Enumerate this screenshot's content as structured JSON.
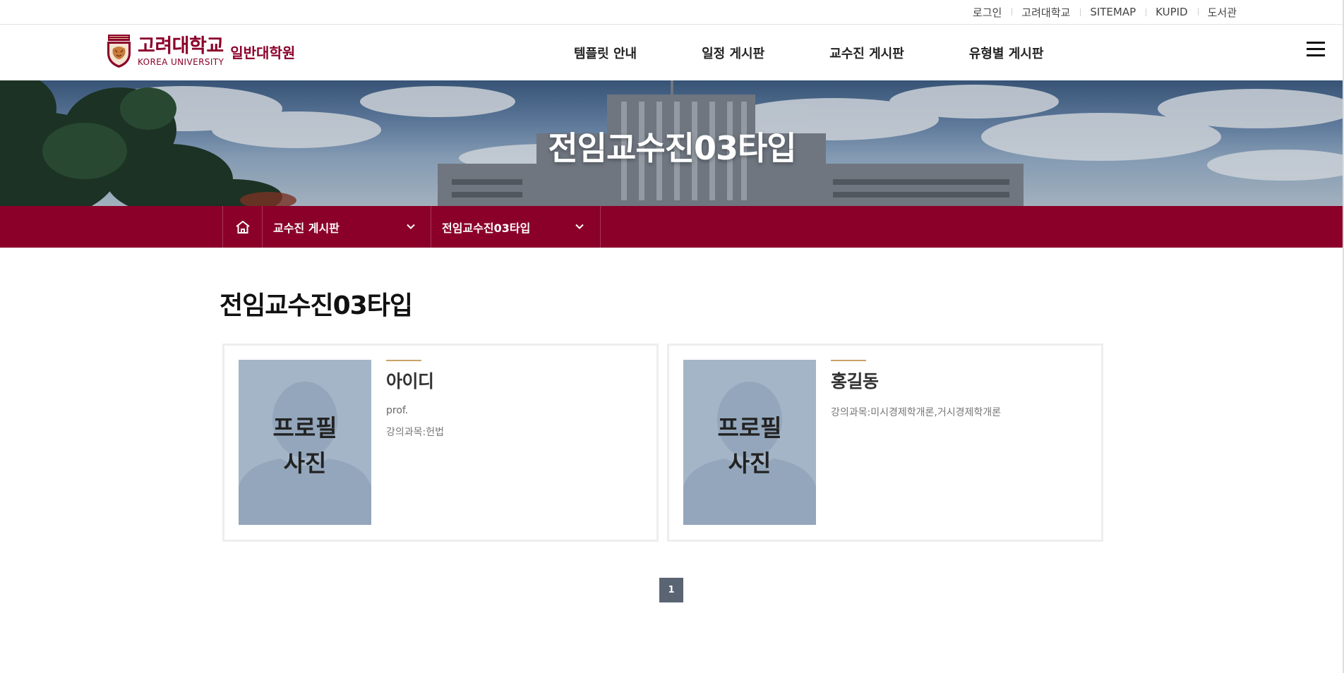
{
  "utility": {
    "links": [
      "로그인",
      "고려대학교",
      "SITEMAP",
      "KUPID",
      "도서관"
    ]
  },
  "header": {
    "logo_ko": "고려대학교",
    "logo_en": "KOREA UNIVERSITY",
    "logo_grad": "일반대학원",
    "menu": [
      "템플릿 안내",
      "일정 게시판",
      "교수진 게시판",
      "유형별 게시판"
    ],
    "menu_icon": "hamburger-icon"
  },
  "banner": {
    "title": "전임교수진03타입"
  },
  "location": {
    "home_icon": "home-icon",
    "depth1": "교수진 게시판",
    "depth2": "전임교수진03타입"
  },
  "content": {
    "title": "전임교수진03타입",
    "cards": [
      {
        "photo_label_1": "프로필",
        "photo_label_2": "사진",
        "name": "아이디",
        "position": "prof.",
        "course": "강의과목:헌법"
      },
      {
        "photo_label_1": "프로필",
        "photo_label_2": "사진",
        "name": "홍길동",
        "course": "강의과목:미시경제학개론,거시경제학개론"
      }
    ]
  },
  "pagination": {
    "current": "1"
  },
  "colors": {
    "brand": "#8b0029",
    "accent_bar": "#c9a468",
    "pagination": "#5b6473"
  }
}
